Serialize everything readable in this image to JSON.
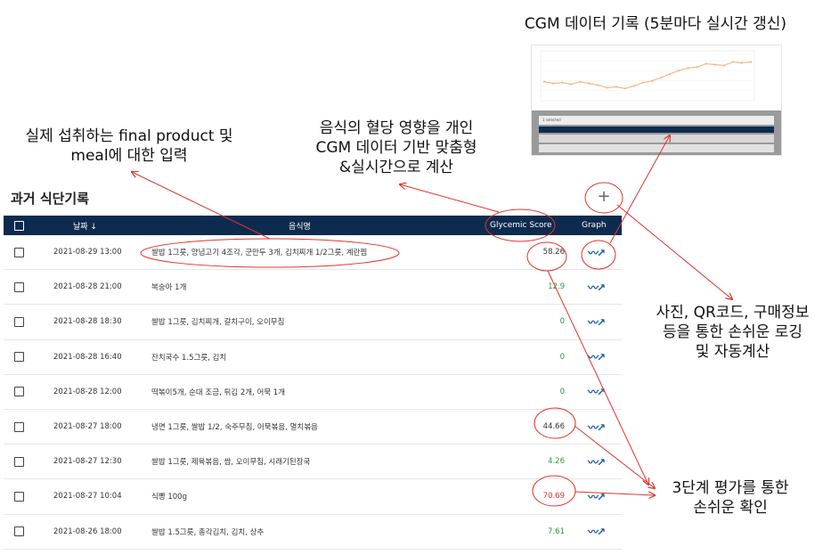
{
  "annotations": {
    "cgm_title": "CGM 데이터 기록 (5분마다 실시간 갱신)",
    "input_line1": "실제 섭취하는 final product 및",
    "input_line2": "meal에 대한 입력",
    "score_line1": "음식의 혈당 영향을 개인",
    "score_line2": "CGM 데이터 기반 맞춤형",
    "score_line3": "&실시간으로 계산",
    "logging_line1": "사진, QR코드, 구매정보",
    "logging_line2": "등을 통한 손쉬운 로깅",
    "logging_line3": "및 자동계산",
    "eval_line1": "3단계 평가를 통한",
    "eval_line2": "손쉬운 확인"
  },
  "page": {
    "title": "과거 식단기록",
    "add_label": "+"
  },
  "table": {
    "headers": {
      "date": "날짜 ↓",
      "food": "음식명",
      "score": "Glycemic Score",
      "graph": "Graph"
    },
    "rows": [
      {
        "date": "2021-08-29 13:00",
        "food": "쌀밥 1그릇, 양념고기 4조각, 군만두 3개, 김치찌개 1/2그릇, 계란찜",
        "score": "58.26",
        "level": "mid"
      },
      {
        "date": "2021-08-28 21:00",
        "food": "복숭아 1개",
        "score": "12.9",
        "level": "low"
      },
      {
        "date": "2021-08-28 18:30",
        "food": "쌀밥 1그릇, 김치찌개, 갈치구이, 오이무침",
        "score": "0",
        "level": "low"
      },
      {
        "date": "2021-08-28 16:40",
        "food": "잔치국수 1.5그릇, 김치",
        "score": "0",
        "level": "low"
      },
      {
        "date": "2021-08-28 12:00",
        "food": "떡볶이5개, 순대 조금, 튀김 2개, 어묵 1개",
        "score": "0",
        "level": "low"
      },
      {
        "date": "2021-08-27 18:00",
        "food": "냉면 1그릇, 쌀밥 1/2, 숙주무침, 어묵볶음, 멸치볶음",
        "score": "44.66",
        "level": "mid"
      },
      {
        "date": "2021-08-27 12:30",
        "food": "쌀밥 1그릇, 제육볶음, 쌈, 오이무침, 시래기된장국",
        "score": "4.26",
        "level": "low"
      },
      {
        "date": "2021-08-27 10:04",
        "food": "식빵 100g",
        "score": "70.69",
        "level": "high"
      },
      {
        "date": "2021-08-26 18:00",
        "food": "쌀밥 1.5그릇, 총각김치, 김치, 상추",
        "score": "7.61",
        "level": "low"
      }
    ]
  },
  "thumbnail": {
    "selection_text": "1 selected",
    "cgm_values": [
      108,
      106,
      107,
      105,
      108,
      106,
      104,
      101,
      102,
      100,
      103,
      107,
      109,
      113,
      117,
      121,
      124,
      125,
      129,
      128,
      127,
      131,
      130,
      131
    ]
  },
  "colors": {
    "header_bg": "#0d2b4f",
    "score_low": "#2e9b3a",
    "score_high": "#e2342a",
    "annotation": "#e2342a",
    "cgm_line": "#f2b98a"
  },
  "icons": {
    "graph": "trend-graph-icon",
    "add": "plus-icon",
    "sort": "arrow-down-icon"
  }
}
